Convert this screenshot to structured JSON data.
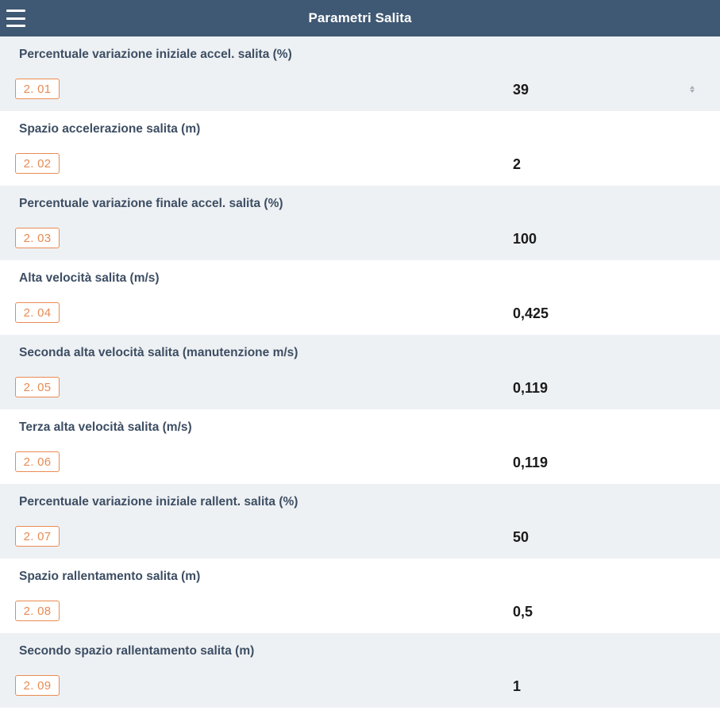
{
  "header": {
    "title": "Parametri Salita"
  },
  "parameters": [
    {
      "label": "Percentuale variazione iniziale accel. salita (%)",
      "code": "2. 01",
      "value": "39"
    },
    {
      "label": "Spazio accelerazione salita (m)",
      "code": "2. 02",
      "value": "2"
    },
    {
      "label": "Percentuale variazione finale accel. salita (%)",
      "code": "2. 03",
      "value": "100"
    },
    {
      "label": "Alta velocità salita (m/s)",
      "code": "2. 04",
      "value": "0,425"
    },
    {
      "label": "Seconda alta velocità salita (manutenzione m/s)",
      "code": "2. 05",
      "value": "0,119"
    },
    {
      "label": "Terza alta velocità salita (m/s)",
      "code": "2. 06",
      "value": "0,119"
    },
    {
      "label": "Percentuale variazione iniziale rallent. salita (%)",
      "code": "2. 07",
      "value": "50"
    },
    {
      "label": "Spazio rallentamento salita (m)",
      "code": "2. 08",
      "value": "0,5"
    },
    {
      "label": "Secondo spazio rallentamento salita (m)",
      "code": "2. 09",
      "value": "1"
    }
  ],
  "colors": {
    "header_bg": "#3f5873",
    "row_alt_bg": "#eef1f4",
    "badge_accent": "#e98b52",
    "label_text": "#3d4e63"
  },
  "icons": {
    "menu": "hamburger-menu-icon",
    "spinner": "stepper-arrows-icon"
  }
}
